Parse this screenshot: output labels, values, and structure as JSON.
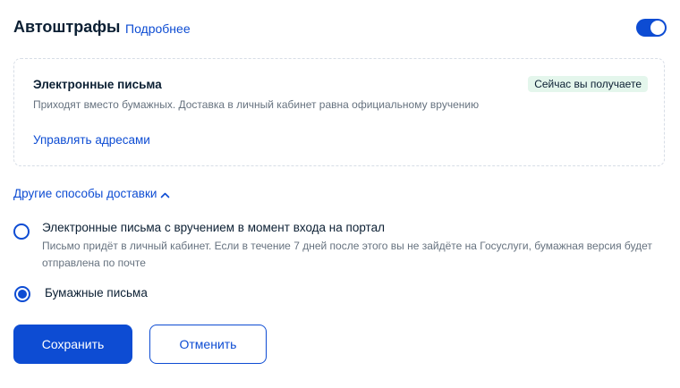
{
  "header": {
    "title": "Автоштрафы",
    "details_link": "Подробнее",
    "toggle_on": true
  },
  "card": {
    "title": "Электронные письма",
    "badge": "Сейчас вы получаете",
    "description": "Приходят вместо бумажных. Доставка в личный кабинет равна официальному вручению",
    "manage_link": "Управлять адресами"
  },
  "other_ways": {
    "label": "Другие способы доставки",
    "expanded": true,
    "options": [
      {
        "label": "Электронные письма с вручением в момент входа на портал",
        "description": "Письмо придёт в личный кабинет. Если в течение 7 дней после этого вы не зайдёте на Госуслуги, бумажная версия будет отправлена по почте",
        "selected": false
      },
      {
        "label": "Бумажные письма",
        "selected": true
      }
    ]
  },
  "buttons": {
    "save": "Сохранить",
    "cancel": "Отменить"
  },
  "colors": {
    "accent": "#0d4cd3",
    "text": "#0b1f33",
    "muted": "#66727f",
    "badge_bg": "#e4f6ec",
    "card_border": "#d7dde6"
  },
  "icons": {
    "expand": "chevron-up-icon"
  }
}
